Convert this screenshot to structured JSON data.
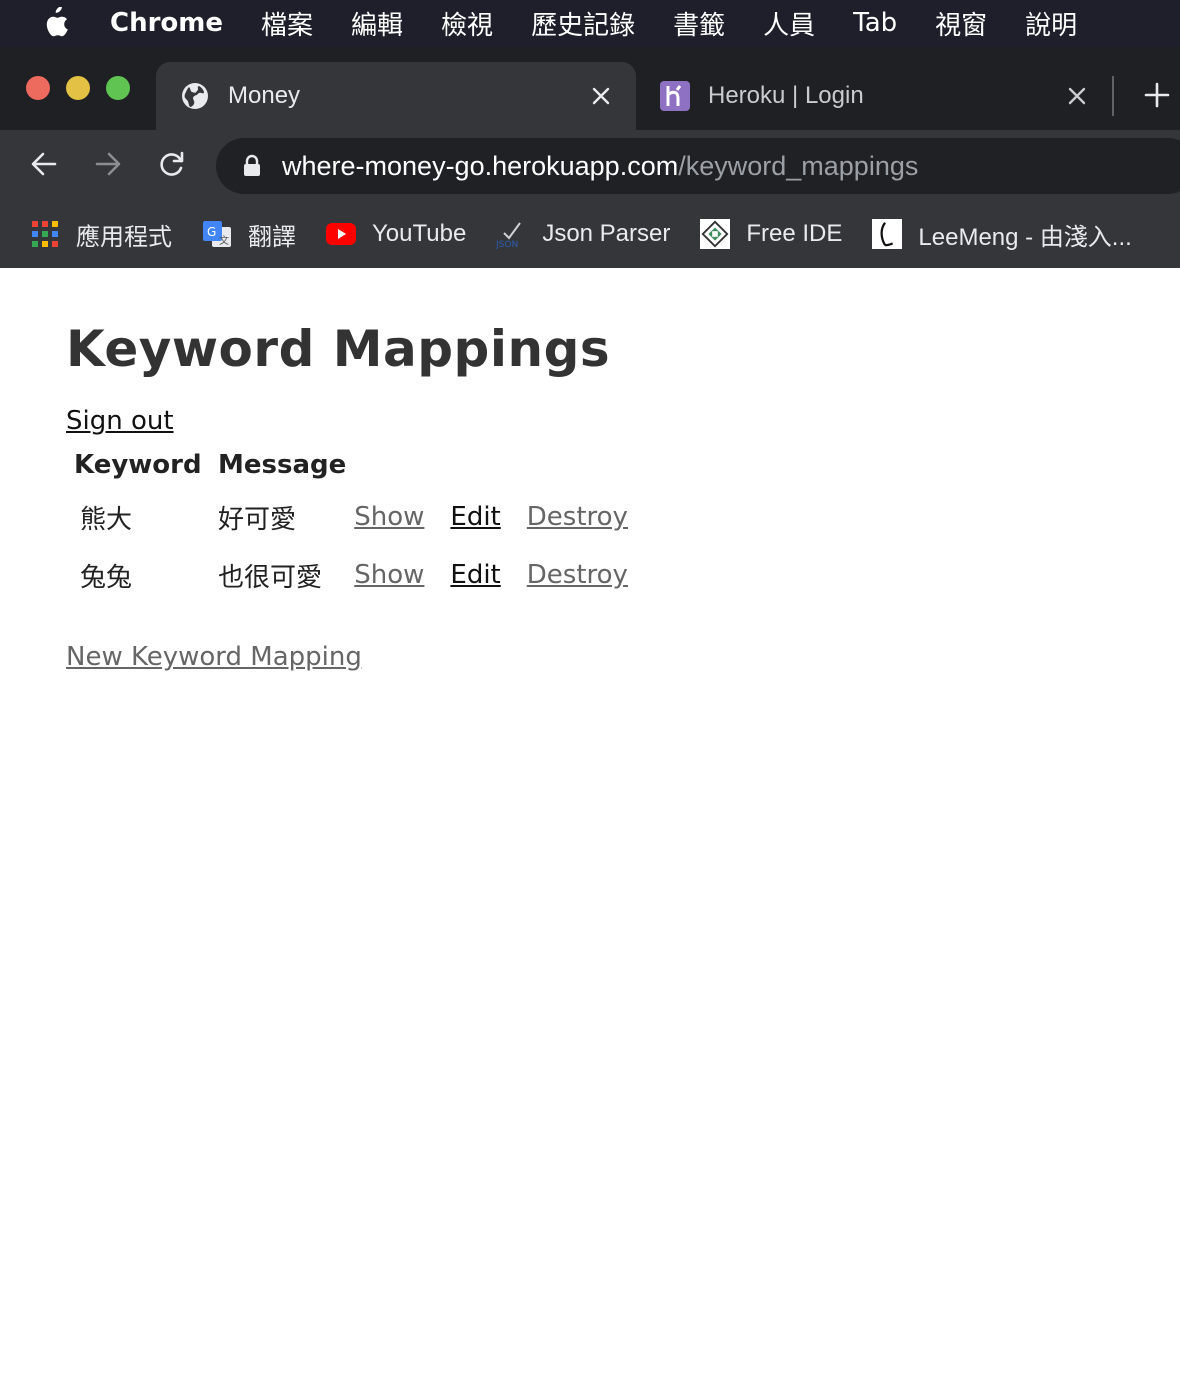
{
  "menubar": {
    "app_name": "Chrome",
    "items": [
      "檔案",
      "編輯",
      "檢視",
      "歷史記錄",
      "書籤",
      "人員",
      "Tab",
      "視窗",
      "說明"
    ]
  },
  "tabs": [
    {
      "title": "Money",
      "icon": "globe-icon"
    },
    {
      "title": "Heroku | Login",
      "icon": "heroku-icon"
    }
  ],
  "omnibox": {
    "host": "where-money-go.herokuapp.com",
    "path": "/keyword_mappings"
  },
  "bookmarks": [
    {
      "label": "應用程式",
      "icon": "apps-grid-icon"
    },
    {
      "label": "翻譯",
      "icon": "google-translate-icon"
    },
    {
      "label": "YouTube",
      "icon": "youtube-icon"
    },
    {
      "label": "Json Parser",
      "icon": "json-icon"
    },
    {
      "label": "Free IDE",
      "icon": "free-ide-icon"
    },
    {
      "label": "LeeMeng - 由淺入...",
      "icon": "leemeng-icon"
    }
  ],
  "page": {
    "title": "Keyword Mappings",
    "sign_out": "Sign out",
    "headers": {
      "keyword": "Keyword",
      "message": "Message"
    },
    "rows": [
      {
        "keyword": "熊大",
        "message": "好可愛",
        "show": "Show",
        "edit": "Edit",
        "destroy": "Destroy"
      },
      {
        "keyword": "兔兔",
        "message": "也很可愛",
        "show": "Show",
        "edit": "Edit",
        "destroy": "Destroy"
      }
    ],
    "new_link": "New Keyword Mapping"
  },
  "colors": {
    "menubar_bg": "#1e1f2b",
    "tabstrip_bg": "#1f2023",
    "toolbar_bg": "#35363a",
    "omnibox_bg": "#202124",
    "link_grey": "#666666"
  }
}
